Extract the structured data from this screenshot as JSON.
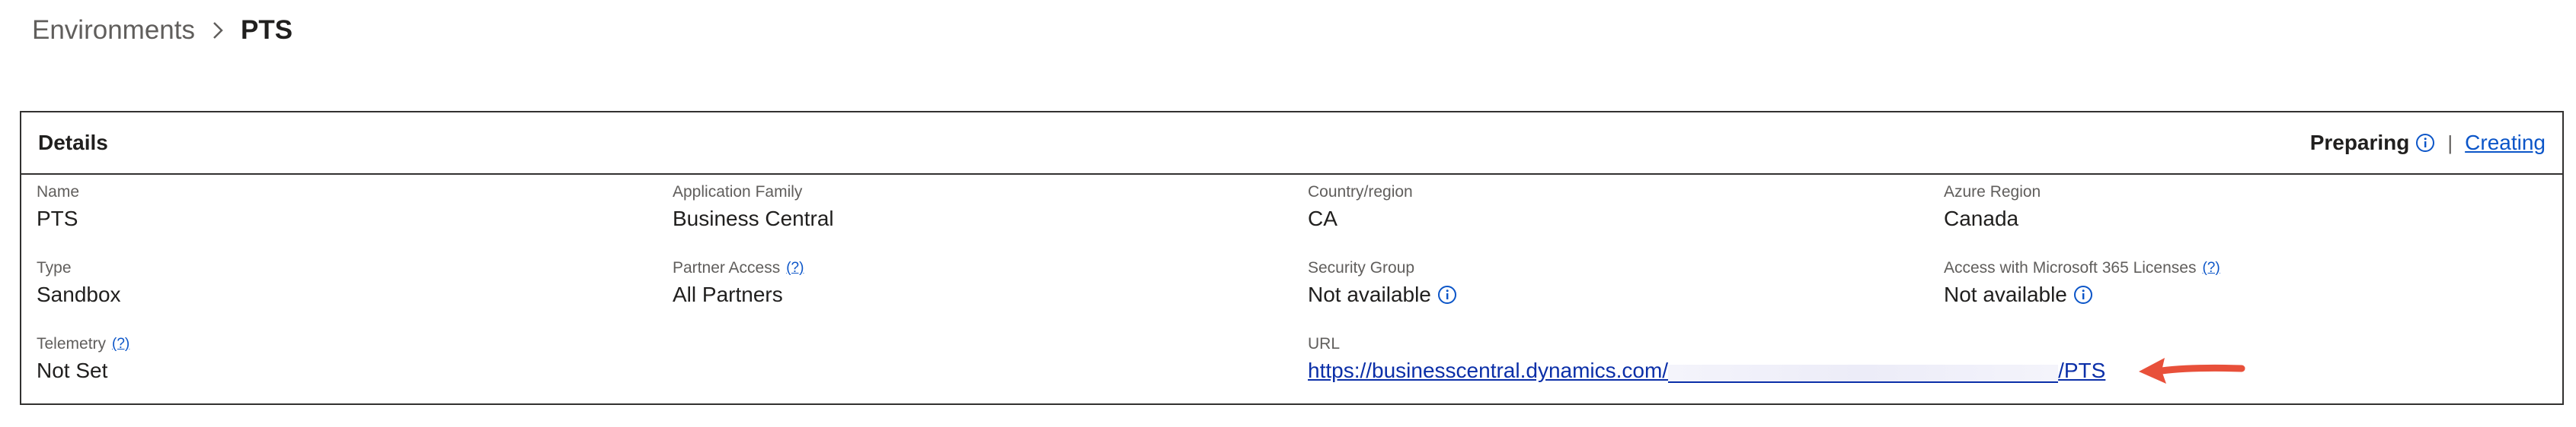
{
  "breadcrumb": {
    "parent": "Environments",
    "current": "PTS"
  },
  "details": {
    "title": "Details",
    "status": "Preparing",
    "status_separator": "|",
    "status_link": "Creating",
    "fields": {
      "name": {
        "label": "Name",
        "value": "PTS"
      },
      "app_family": {
        "label": "Application Family",
        "value": "Business Central"
      },
      "country": {
        "label": "Country/region",
        "value": "CA"
      },
      "azure_region": {
        "label": "Azure Region",
        "value": "Canada"
      },
      "type": {
        "label": "Type",
        "value": "Sandbox"
      },
      "partner_access": {
        "label": "Partner Access",
        "help": "(?)",
        "value": "All Partners"
      },
      "security_group": {
        "label": "Security Group",
        "value": "Not available"
      },
      "m365_access": {
        "label": "Access with Microsoft 365 Licenses",
        "help": "(?)",
        "value": "Not available"
      },
      "telemetry": {
        "label": "Telemetry",
        "help": "(?)",
        "value": "Not Set"
      },
      "url": {
        "label": "URL",
        "prefix": "https://businesscentral.dynamics.com/",
        "suffix": "/PTS"
      }
    }
  },
  "colors": {
    "link": "#0b55c8",
    "arrow": "#e8503a",
    "border": "#323130"
  }
}
